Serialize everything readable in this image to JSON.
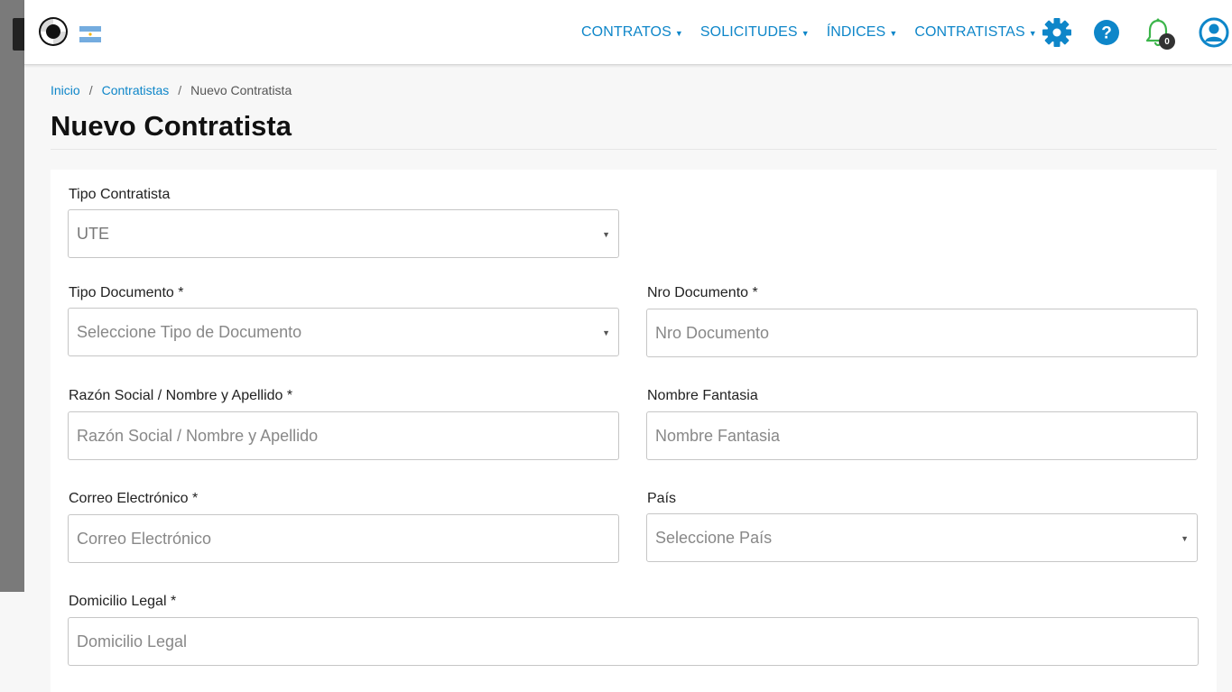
{
  "nav": {
    "items": [
      {
        "label": "CONTRATOS"
      },
      {
        "label": "SOLICITUDES"
      },
      {
        "label": "ÍNDICES"
      },
      {
        "label": "CONTRATISTAS"
      }
    ],
    "notifications_count": "0"
  },
  "colors": {
    "accent": "#0e86c9",
    "bell": "#3bb54a"
  },
  "icons": [
    "logo-icon",
    "flag-icon",
    "gear-icon",
    "help-icon",
    "bell-icon",
    "user-icon"
  ],
  "breadcrumb": {
    "home": "Inicio",
    "section": "Contratistas",
    "current": "Nuevo Contratista",
    "separator": "/"
  },
  "page_title": "Nuevo Contratista",
  "form": {
    "tipo_contratista": {
      "label": "Tipo Contratista",
      "value": "UTE"
    },
    "tipo_documento": {
      "label": "Tipo Documento *",
      "placeholder": "Seleccione Tipo de Documento"
    },
    "nro_documento": {
      "label": "Nro Documento *",
      "placeholder": "Nro Documento"
    },
    "razon_social": {
      "label": "Razón Social / Nombre y Apellido *",
      "placeholder": "Razón Social / Nombre y Apellido"
    },
    "nombre_fantasia": {
      "label": "Nombre Fantasia",
      "placeholder": "Nombre Fantasia"
    },
    "correo": {
      "label": "Correo Electrónico *",
      "placeholder": "Correo Electrónico"
    },
    "pais": {
      "label": "País",
      "placeholder": "Seleccione País"
    },
    "domicilio": {
      "label": "Domicilio Legal *",
      "placeholder": "Domicilio Legal"
    }
  }
}
